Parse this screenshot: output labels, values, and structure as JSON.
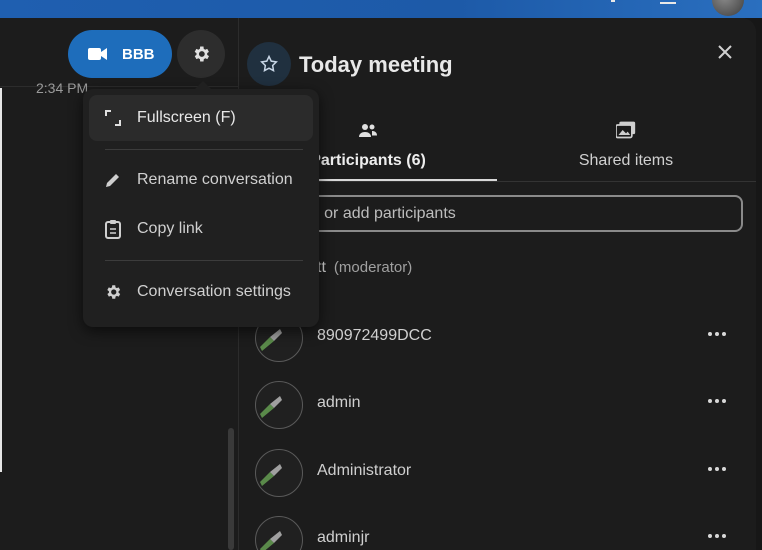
{
  "top": {
    "icons": [
      "bell-icon",
      "menu-icon"
    ],
    "avatar": "user-avatar"
  },
  "chat": {
    "timestamp": "2:34 PM",
    "call_button_label": "BBB",
    "call_icon": "video-icon",
    "settings_icon": "gear-icon"
  },
  "menu": {
    "items": [
      {
        "label": "Fullscreen (F)",
        "icon": "fullscreen-icon"
      },
      {
        "label": "Rename conversation",
        "icon": "pencil-icon"
      },
      {
        "label": "Copy link",
        "icon": "clipboard-icon"
      },
      {
        "label": "Conversation settings",
        "icon": "gear-icon"
      }
    ]
  },
  "sidebar": {
    "title": "Today meeting",
    "tabs": [
      {
        "label": "Participants (6)",
        "icon": "people-icon"
      },
      {
        "label": "Shared items",
        "icon": "images-icon"
      }
    ],
    "search_placeholder": "Search or add participants",
    "participants": [
      {
        "name": "tt",
        "role": "(moderator)"
      },
      {
        "name": "890972499DCC"
      },
      {
        "name": "admin"
      },
      {
        "name": "Administrator"
      },
      {
        "name": "adminjr"
      }
    ]
  },
  "colors": {
    "accent": "#1e6dbb",
    "background": "#1c1c1c",
    "topbar": "#1f5fb0"
  }
}
